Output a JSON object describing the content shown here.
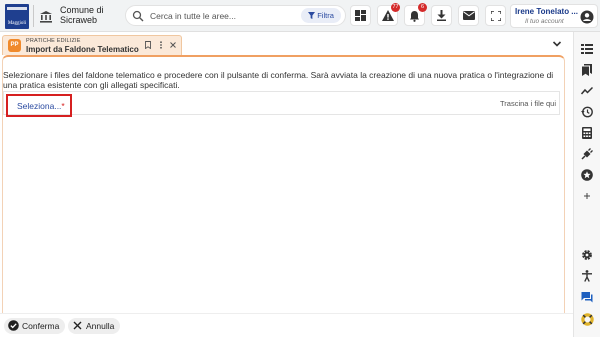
{
  "header": {
    "logo_text": "Maggioli",
    "org_name_line1": "Comune di",
    "org_name_line2": "Sicraweb",
    "search_placeholder": "Cerca in tutte le aree...",
    "filter_label": "Filtra",
    "alerts_badge": "77",
    "notifications_badge": "6",
    "user_name": "Irene Tonelato ...",
    "user_sub": "Il tuo account"
  },
  "tab": {
    "icon_text": "PP",
    "category": "PRATICHE EDILIZIE",
    "title": "Import da Faldone Telematico"
  },
  "content": {
    "description": "Selezionare i files del faldone telematico e procedere con il pulsante di conferma. Sarà avviata la creazione di una nuova pratica o l'integrazione di una pratica esistente con gli allegati specificati.",
    "select_label": "Seleziona...",
    "required_mark": "*",
    "drop_hint": "Trascina i file qui"
  },
  "footer": {
    "confirm_label": "Conferma",
    "cancel_label": "Annulla"
  },
  "colors": {
    "accent_orange": "#f08a2c",
    "brand_blue": "#1f3f8f",
    "highlight_red": "#d62020"
  }
}
